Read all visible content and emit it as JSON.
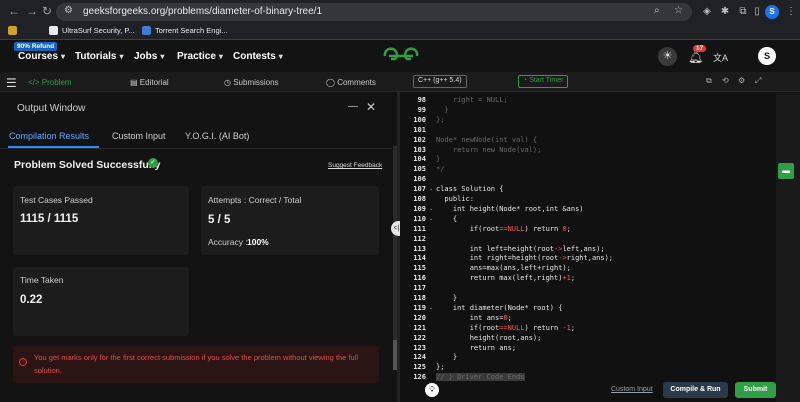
{
  "browser": {
    "url": "geeksforgeeks.org/problems/diameter-of-binary-tree/1",
    "profile_initial": "S",
    "bookmarks": [
      {
        "label": "UltraSurf Security, P..."
      },
      {
        "label": "Torrent Search Engi..."
      }
    ]
  },
  "site_header": {
    "refund_badge": "90% Refund",
    "nav": [
      "Courses",
      "Tutorials",
      "Jobs",
      "Practice",
      "Contests"
    ],
    "notification_count": "17",
    "user_initial": "S"
  },
  "problem_tabs": {
    "tabs": [
      "Problem",
      "Editorial",
      "Submissions",
      "Comments"
    ],
    "language": "C++ (g++ 5.4)",
    "timer_label": "Start Timer"
  },
  "output_window": {
    "title": "Output Window",
    "tabs": [
      "Compilation Results",
      "Custom Input",
      "Y.O.G.I. (AI Bot)"
    ],
    "status": "Problem Solved Successfully",
    "feedback_link": "Suggest Feedback",
    "test_cases_label": "Test Cases Passed",
    "test_cases_value": "1115 / 1115",
    "attempts_label": "Attempts : Correct / Total",
    "attempts_value": "5 / 5",
    "accuracy_label": "Accuracy :",
    "accuracy_value": "100%",
    "time_label": "Time Taken",
    "time_value": "0.22",
    "warning": "You get marks only for the first correct submission if you solve the problem without viewing the full solution."
  },
  "editor": {
    "lines": [
      {
        "n": "98",
        "t": "    right = NULL;"
      },
      {
        "n": "99",
        "t": "  }"
      },
      {
        "n": "100",
        "t": "};"
      },
      {
        "n": "101",
        "t": ""
      },
      {
        "n": "102",
        "t": "Node* newNode(int val) {"
      },
      {
        "n": "103",
        "t": "    return new Node(val);"
      },
      {
        "n": "104",
        "t": "}"
      },
      {
        "n": "105",
        "t": "*/"
      },
      {
        "n": "106",
        "t": ""
      },
      {
        "n": "107",
        "t": "class Solution {"
      },
      {
        "n": "108",
        "t": "  public:"
      },
      {
        "n": "109",
        "t": "    int height(Node* root,int &ans)"
      },
      {
        "n": "110",
        "t": "    {"
      },
      {
        "n": "111",
        "t": "        if(root==NULL) return 0;"
      },
      {
        "n": "112",
        "t": ""
      },
      {
        "n": "113",
        "t": "        int left=height(root->left,ans);"
      },
      {
        "n": "114",
        "t": "        int right=height(root->right,ans);"
      },
      {
        "n": "115",
        "t": "        ans=max(ans,left+right);"
      },
      {
        "n": "116",
        "t": "        return max(left,right)+1;"
      },
      {
        "n": "117",
        "t": ""
      },
      {
        "n": "118",
        "t": "    }"
      },
      {
        "n": "119",
        "t": "    int diameter(Node* root) {"
      },
      {
        "n": "120",
        "t": "        int ans=0;"
      },
      {
        "n": "121",
        "t": "        if(root==NULL) return -1;"
      },
      {
        "n": "122",
        "t": "        height(root,ans);"
      },
      {
        "n": "123",
        "t": "        return ans;"
      },
      {
        "n": "124",
        "t": "    }"
      },
      {
        "n": "125",
        "t": "};"
      },
      {
        "n": "126",
        "t": "// } Driver Code Ends"
      }
    ]
  },
  "footer": {
    "custom_input": "Custom Input",
    "compile_run": "Compile & Run",
    "submit": "Submit"
  }
}
